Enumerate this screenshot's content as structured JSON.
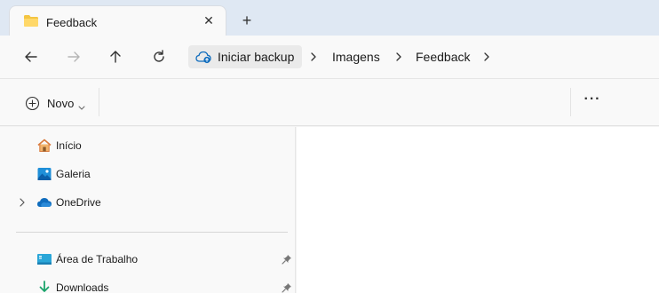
{
  "window": {
    "tab_title": "Feedback",
    "close_glyph": "✕",
    "new_tab_glyph": "+"
  },
  "breadcrumb": {
    "root_label": "Iniciar backup",
    "items": [
      "Imagens",
      "Feedback"
    ]
  },
  "command_bar": {
    "new_label": "Novo",
    "more_glyph": "···"
  },
  "sidebar": {
    "items": [
      {
        "label": "Início",
        "icon": "home-icon"
      },
      {
        "label": "Galeria",
        "icon": "gallery-icon"
      },
      {
        "label": "OneDrive",
        "icon": "onedrive-cloud-icon"
      },
      {
        "label": "Área de Trabalho",
        "icon": "desktop-icon"
      },
      {
        "label": "Downloads",
        "icon": "downloads-icon"
      }
    ]
  },
  "colors": {
    "tabbar_bg": "#dfe8f3",
    "folder_yellow": "#f4c542",
    "accent_blue": "#0f6cbd"
  }
}
